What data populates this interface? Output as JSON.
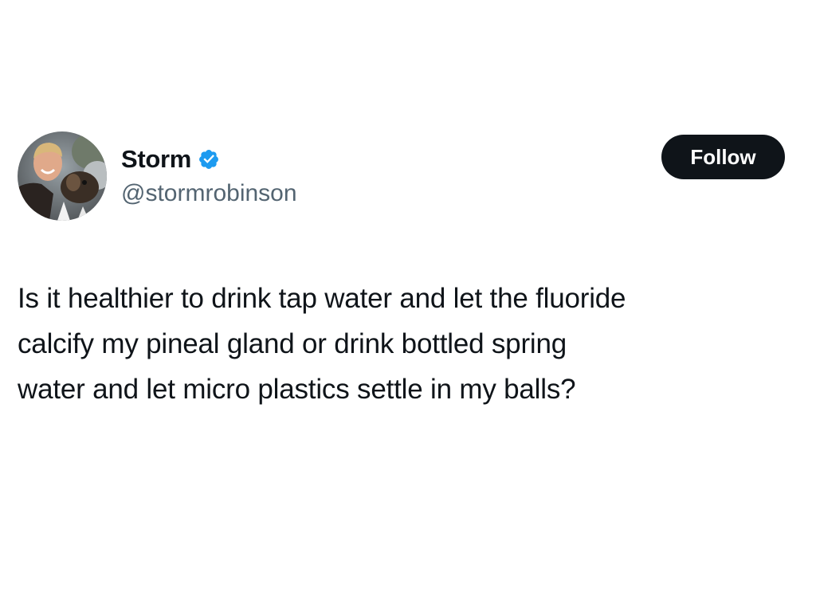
{
  "author": {
    "display_name": "Storm",
    "handle": "@stormrobinson",
    "verified": true,
    "verified_badge_color": "#1d9bf0",
    "avatar_icon": "profile-photo-icon"
  },
  "actions": {
    "follow_label": "Follow"
  },
  "tweet": {
    "lines": [
      "Is it healthier to drink tap water and let the fluoride",
      "calcify my pineal gland or drink bottled spring",
      "water and let micro plastics settle in my balls?"
    ]
  },
  "colors": {
    "text_primary": "#0f1419",
    "text_secondary": "#536471",
    "button_bg": "#0f1419",
    "button_text": "#ffffff"
  }
}
